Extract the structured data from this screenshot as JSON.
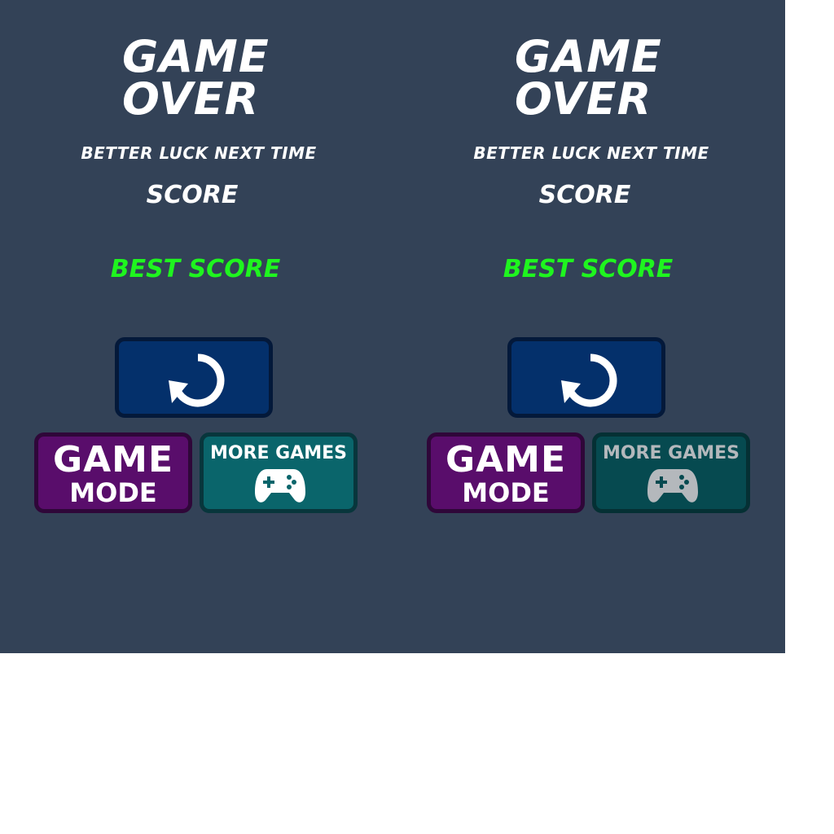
{
  "screens": [
    {
      "title_line1": "GAME",
      "title_line2": "OVER",
      "subtitle": "BETTER LUCK NEXT TIME",
      "score_label": "SCORE",
      "best_score_label": "BEST SCORE",
      "restart_icon": "restart-icon",
      "game_mode_line1": "GAME",
      "game_mode_line2": "MODE",
      "more_games_label": "MORE GAMES",
      "more_games_icon": "gamepad-icon",
      "more_games_state": "normal"
    },
    {
      "title_line1": "GAME",
      "title_line2": "OVER",
      "subtitle": "BETTER LUCK NEXT TIME",
      "score_label": "SCORE",
      "best_score_label": "BEST SCORE",
      "restart_icon": "restart-icon",
      "game_mode_line1": "GAME",
      "game_mode_line2": "MODE",
      "more_games_label": "MORE GAMES",
      "more_games_icon": "gamepad-icon",
      "more_games_state": "pressed"
    }
  ],
  "colors": {
    "background": "#334257",
    "text": "#ffffff",
    "best_score": "#1ff51f",
    "restart_button": "#04306b",
    "game_mode_button": "#590d6b",
    "more_games_button": "#0a656b",
    "more_games_button_pressed": "#064a50"
  }
}
